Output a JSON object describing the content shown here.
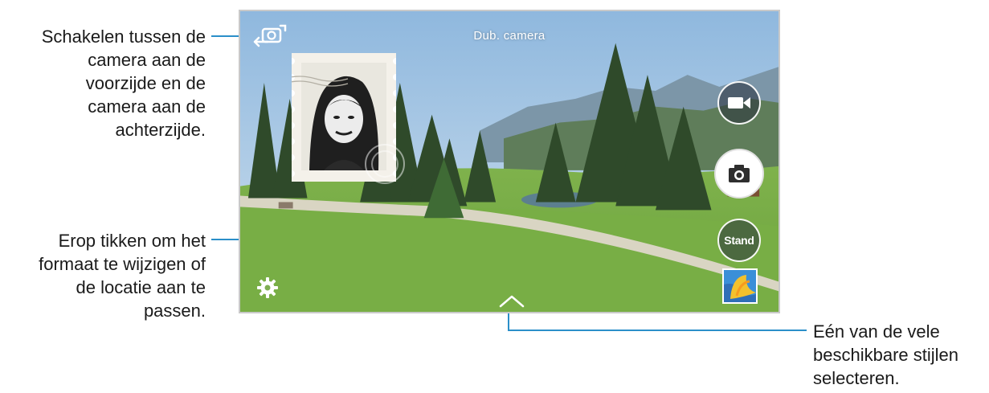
{
  "annotations": {
    "switch_camera": [
      "Schakelen tussen de",
      "camera aan de",
      "voorzijde en de",
      "camera aan de",
      "achterzijde."
    ],
    "resize_stamp": [
      "Erop tikken om het",
      "formaat te wijzigen of",
      "de locatie aan te",
      "passen."
    ],
    "select_style": [
      "Eén van de vele",
      "beschikbare stijlen",
      "selecteren."
    ]
  },
  "camera": {
    "mode_title": "Dub. camera",
    "mode_button_label": "Stand"
  },
  "icons": {
    "switch": "camera-switch-icon",
    "video": "video-camera-icon",
    "photo": "camera-icon",
    "settings": "gear-icon",
    "styles": "chevron-up-icon",
    "gallery": "gallery-thumbnail"
  },
  "colors": {
    "accent_line": "#2b8fc9"
  }
}
